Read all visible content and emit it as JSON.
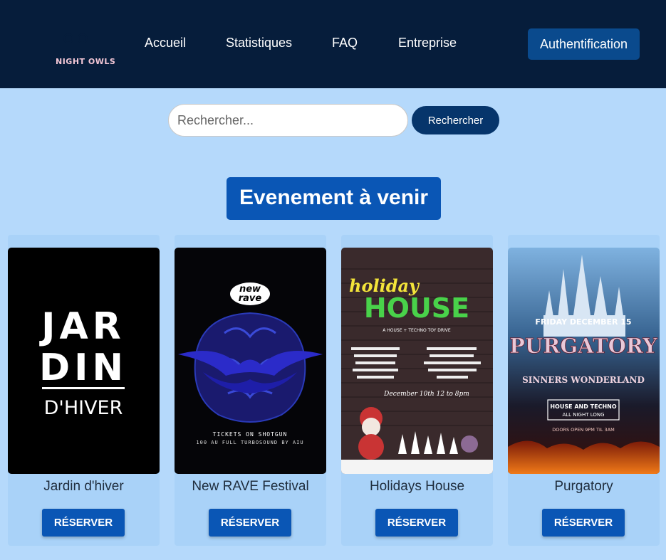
{
  "header": {
    "logo_text": "NIGHT OWLS",
    "nav": [
      {
        "label": "Accueil"
      },
      {
        "label": "Statistiques"
      },
      {
        "label": "FAQ"
      },
      {
        "label": "Entreprise"
      }
    ],
    "auth_label": "Authentification"
  },
  "search": {
    "placeholder": "Rechercher...",
    "button_label": "Rechercher"
  },
  "section": {
    "title": "Evenement à venir"
  },
  "events": [
    {
      "title": "Jardin d'hiver",
      "button": "RÉSERVER",
      "poster": {
        "line1": "JAR",
        "line2": "DIN",
        "line3": "D'HIVER"
      }
    },
    {
      "title": "New RAVE Festival",
      "button": "RÉSERVER",
      "poster": {
        "logo_top": "new",
        "logo_bottom": "rave",
        "footer1": "TICKETS ON SHOTGUN",
        "footer2": "100 AU FULL TURBOSOUND BY AIU"
      }
    },
    {
      "title": "Holidays House",
      "button": "RÉSERVER",
      "poster": {
        "word1": "holiday",
        "word2": "HOUSE",
        "tagline": "A HOUSE + TECHNO TOY DRIVE",
        "date": "December 10th 12 to 8pm"
      }
    },
    {
      "title": "Purgatory",
      "button": "RÉSERVER",
      "poster": {
        "date": "FRIDAY DECEMBER 15",
        "name": "PURGATORY",
        "subtitle": "SINNERS WONDERLAND",
        "box1": "HOUSE AND TECHNO",
        "box2": "ALL NIGHT LONG",
        "doors": "DOORS OPEN 9PM TIL 3AM"
      }
    }
  ],
  "colors": {
    "header_bg": "#061d3b",
    "page_bg": "#b5d9fb",
    "primary": "#0a56b5",
    "dark_button": "#06356b"
  }
}
